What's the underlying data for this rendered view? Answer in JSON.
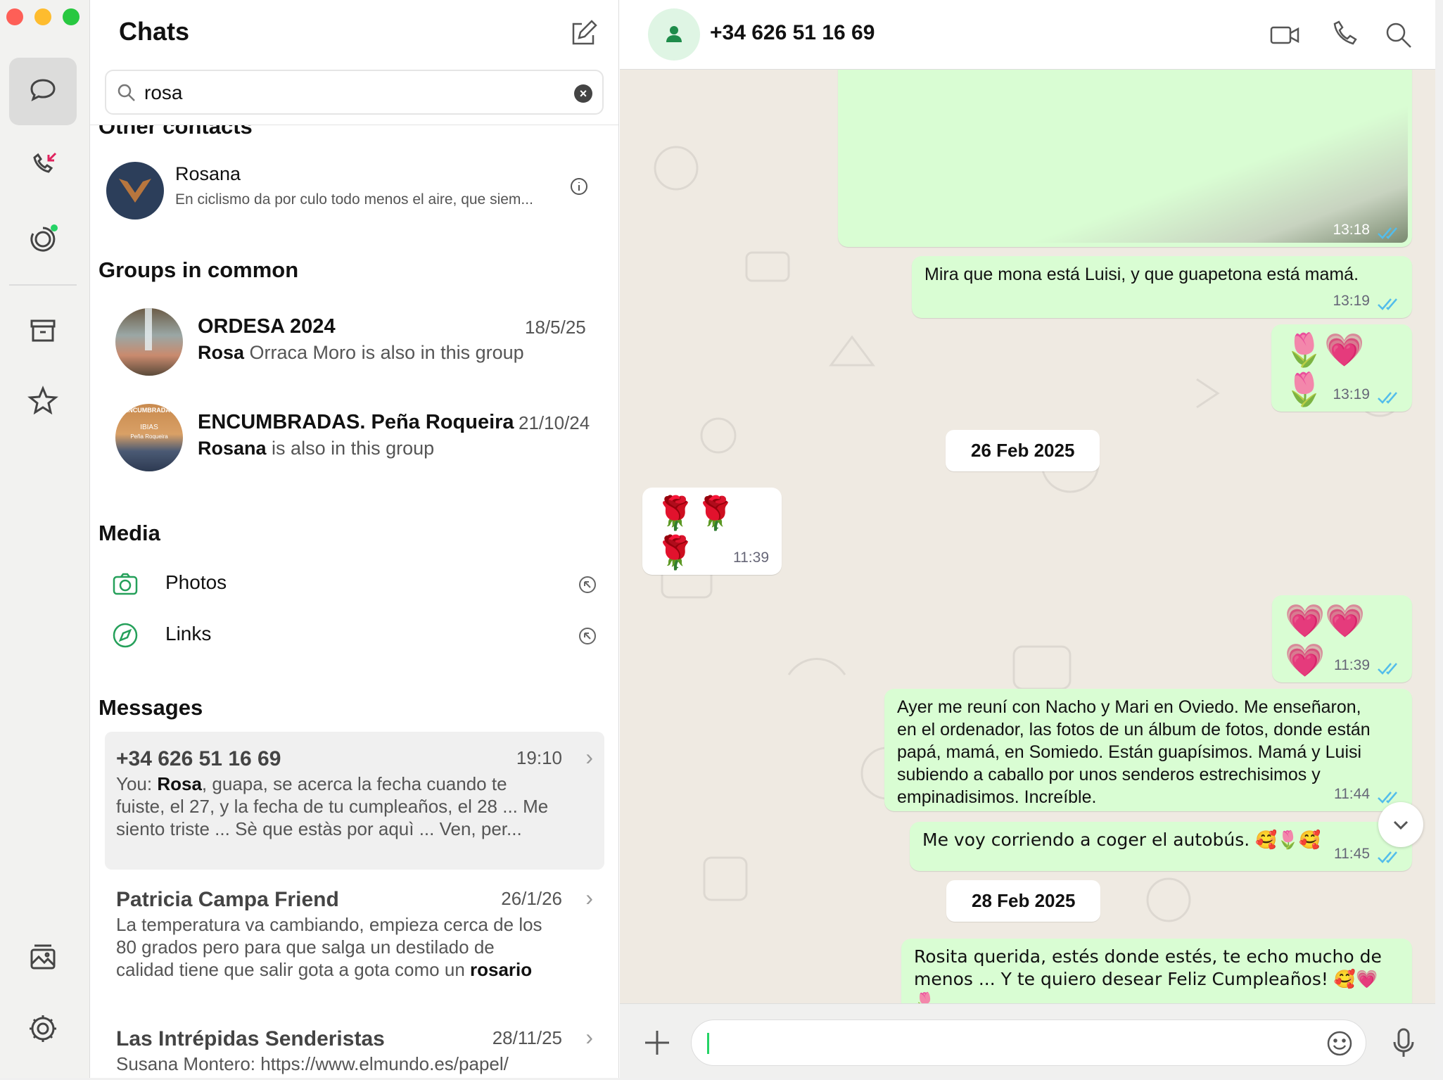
{
  "sidebar": {
    "panel_title": "Chats",
    "search": {
      "value": "rosa",
      "placeholder": ""
    },
    "other_contacts": {
      "title": "Other contacts",
      "items": [
        {
          "name": "Rosana",
          "subtitle": "En ciclismo da por culo todo menos el aire, que siem..."
        }
      ]
    },
    "groups": {
      "title": "Groups in common",
      "items": [
        {
          "name": "ORDESA 2024",
          "date": "18/5/25",
          "highlight": "Rosa",
          "rest": " Orraca Moro is also in this group"
        },
        {
          "name": "ENCUMBRADAS. Peña Roqueira",
          "date": "21/10/24",
          "highlight": "Rosana",
          "rest": " is also in this group",
          "avatar_text_top": "ENCUMBRADAS",
          "avatar_text_mid": "IBIAS",
          "avatar_text_bot": "Peña Roqueira"
        }
      ]
    },
    "media": {
      "title": "Media",
      "items": [
        {
          "label": "Photos"
        },
        {
          "label": "Links"
        }
      ]
    },
    "messages": {
      "title": "Messages",
      "items": [
        {
          "name": "+34 626 51 16 69",
          "date": "19:10",
          "prefix": "You: ",
          "highlight": "Rosa",
          "rest": ", guapa, se acerca la fecha cuando te fuiste, el 27, y la fecha de tu cumpleaños, el 28 ... Me siento triste ... Sè que estàs por aquì ... Ven, per..."
        },
        {
          "name": "Patricia Campa Friend",
          "date": "26/1/26",
          "before": "La temperatura va cambiando, empieza cerca de los 80 grados pero para que salga un destilado de calidad tiene que salir gota a gota como un ",
          "highlight": "rosario"
        },
        {
          "name": "Las Intrépidas Senderistas",
          "date": "28/11/25",
          "prefix": "Susana Montero: ",
          "rest": "https://www.elmundo.es/papel/"
        }
      ]
    }
  },
  "chat": {
    "contact": "+34 626 51 16 69",
    "messages": [
      {
        "time": "13:18"
      },
      {
        "text": "Mira que mona está Luisi, y que guapetona  está mamá.",
        "time": "13:19"
      },
      {
        "text": "🌷💗🌷",
        "time": "13:19"
      },
      {
        "day": "26 Feb 2025"
      },
      {
        "text": "🌹🌹🌹",
        "time": "11:39"
      },
      {
        "text": "💗💗💗",
        "time": "11:39"
      },
      {
        "text": "Ayer me reuní con Nacho y Mari en Oviedo. Me enseñaron, en el ordenador, las fotos de un álbum de fotos, donde están papá, mamá, en Somiedo. Están guapísimos. Mamá y Luisi subiendo a caballo por unos senderos estrechisimos y empinadisimos. Increíble.",
        "time": "11:44"
      },
      {
        "text": "Me voy corriendo a coger el autobús. 🥰🌷🥰",
        "time": "11:45"
      },
      {
        "day": "28 Feb 2025"
      },
      {
        "text": "Rosita querida, estés donde estés, te echo mucho de menos ... Y te quiero desear Feliz Cumpleaños! 🥰💗🌷"
      }
    ],
    "composer": {
      "value": "",
      "placeholder": ""
    }
  },
  "colors": {
    "outgoing_bubble": "#d9fdd3",
    "incoming_bubble": "#ffffff",
    "wallpaper": "#efeae2",
    "tick_blue": "#53bdeb",
    "accent_green": "#25d366"
  }
}
